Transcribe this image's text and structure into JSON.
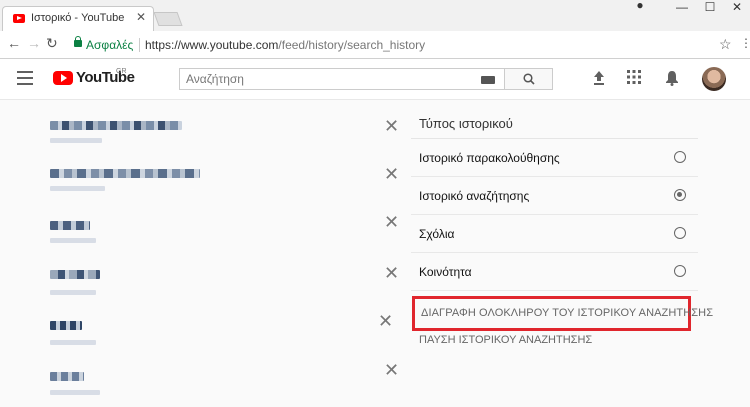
{
  "browser": {
    "tab_title": "Ιστορικό - YouTube",
    "secure_label": "Ασφαλές",
    "url_host": "https://www.youtube.com",
    "url_path": "/feed/history/search_history"
  },
  "header": {
    "logo_text": "YouTube",
    "country": "GR",
    "search_placeholder": "Αναζήτηση"
  },
  "panel": {
    "title": "Τύπος ιστορικού",
    "options": [
      {
        "label": "Ιστορικό παρακολούθησης",
        "selected": false
      },
      {
        "label": "Ιστορικό αναζήτησης",
        "selected": true
      },
      {
        "label": "Σχόλια",
        "selected": false
      },
      {
        "label": "Κοινότητα",
        "selected": false
      }
    ],
    "delete_all": "ΔΙΑΓΡΑΦΗ ΟΛΟΚΛΗΡΟΥ ΤΟΥ ΙΣΤΟΡΙΚΟΥ ΑΝΑΖΗΤΗΣΗΣ",
    "pause": "ΠΑΥΣΗ ΙΣΤΟΡΙΚΟΥ ΑΝΑΖΗΤΗΣΗΣ"
  },
  "colors": {
    "highlight_border": "#e0262d",
    "youtube_red": "#ff0000",
    "secure_green": "#0b8043"
  }
}
